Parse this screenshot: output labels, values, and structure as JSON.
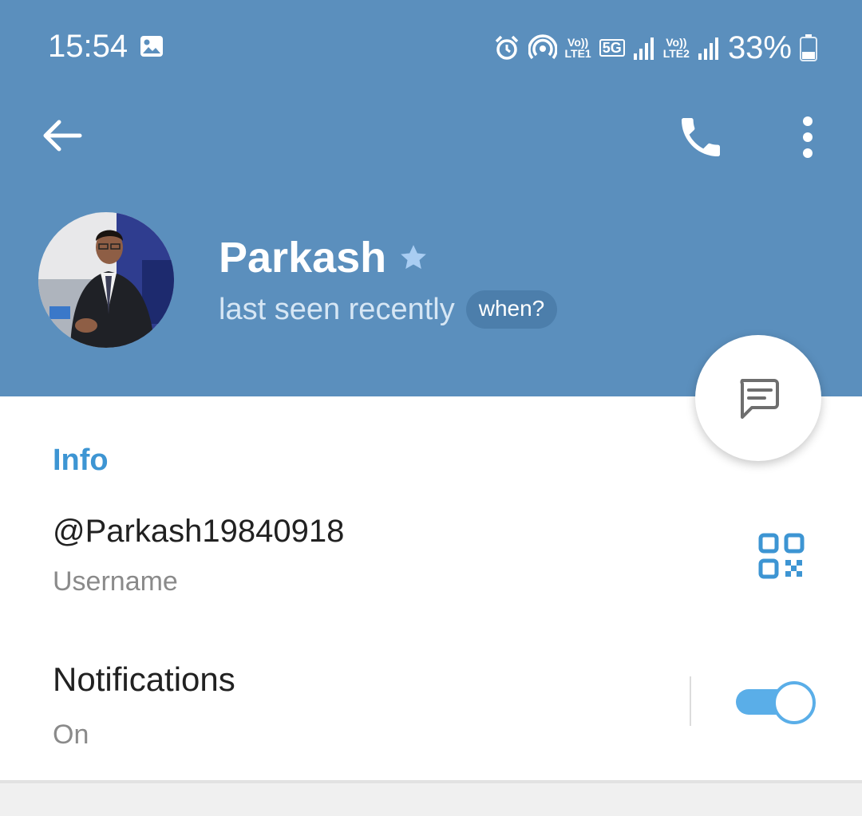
{
  "status_bar": {
    "time": "15:54",
    "sim1_label": "Vo))\nLTE1",
    "sim1_badge": "5G",
    "sim2_label": "Vo))\nLTE2",
    "battery": "33%"
  },
  "profile": {
    "name": "Parkash",
    "status": "last seen recently",
    "when_chip": "when?"
  },
  "info": {
    "section_title": "Info",
    "username": "@Parkash19840918",
    "username_label": "Username"
  },
  "notifications": {
    "title": "Notifications",
    "status": "On",
    "enabled": true
  },
  "colors": {
    "header_bg": "#5b8fbd",
    "accent": "#3d95d3",
    "toggle_on": "#5aaee8"
  },
  "icons": {
    "back": "arrow-left-icon",
    "call": "phone-icon",
    "menu": "more-vertical-icon",
    "message": "message-icon",
    "qr": "qr-code-icon",
    "star": "star-icon"
  }
}
